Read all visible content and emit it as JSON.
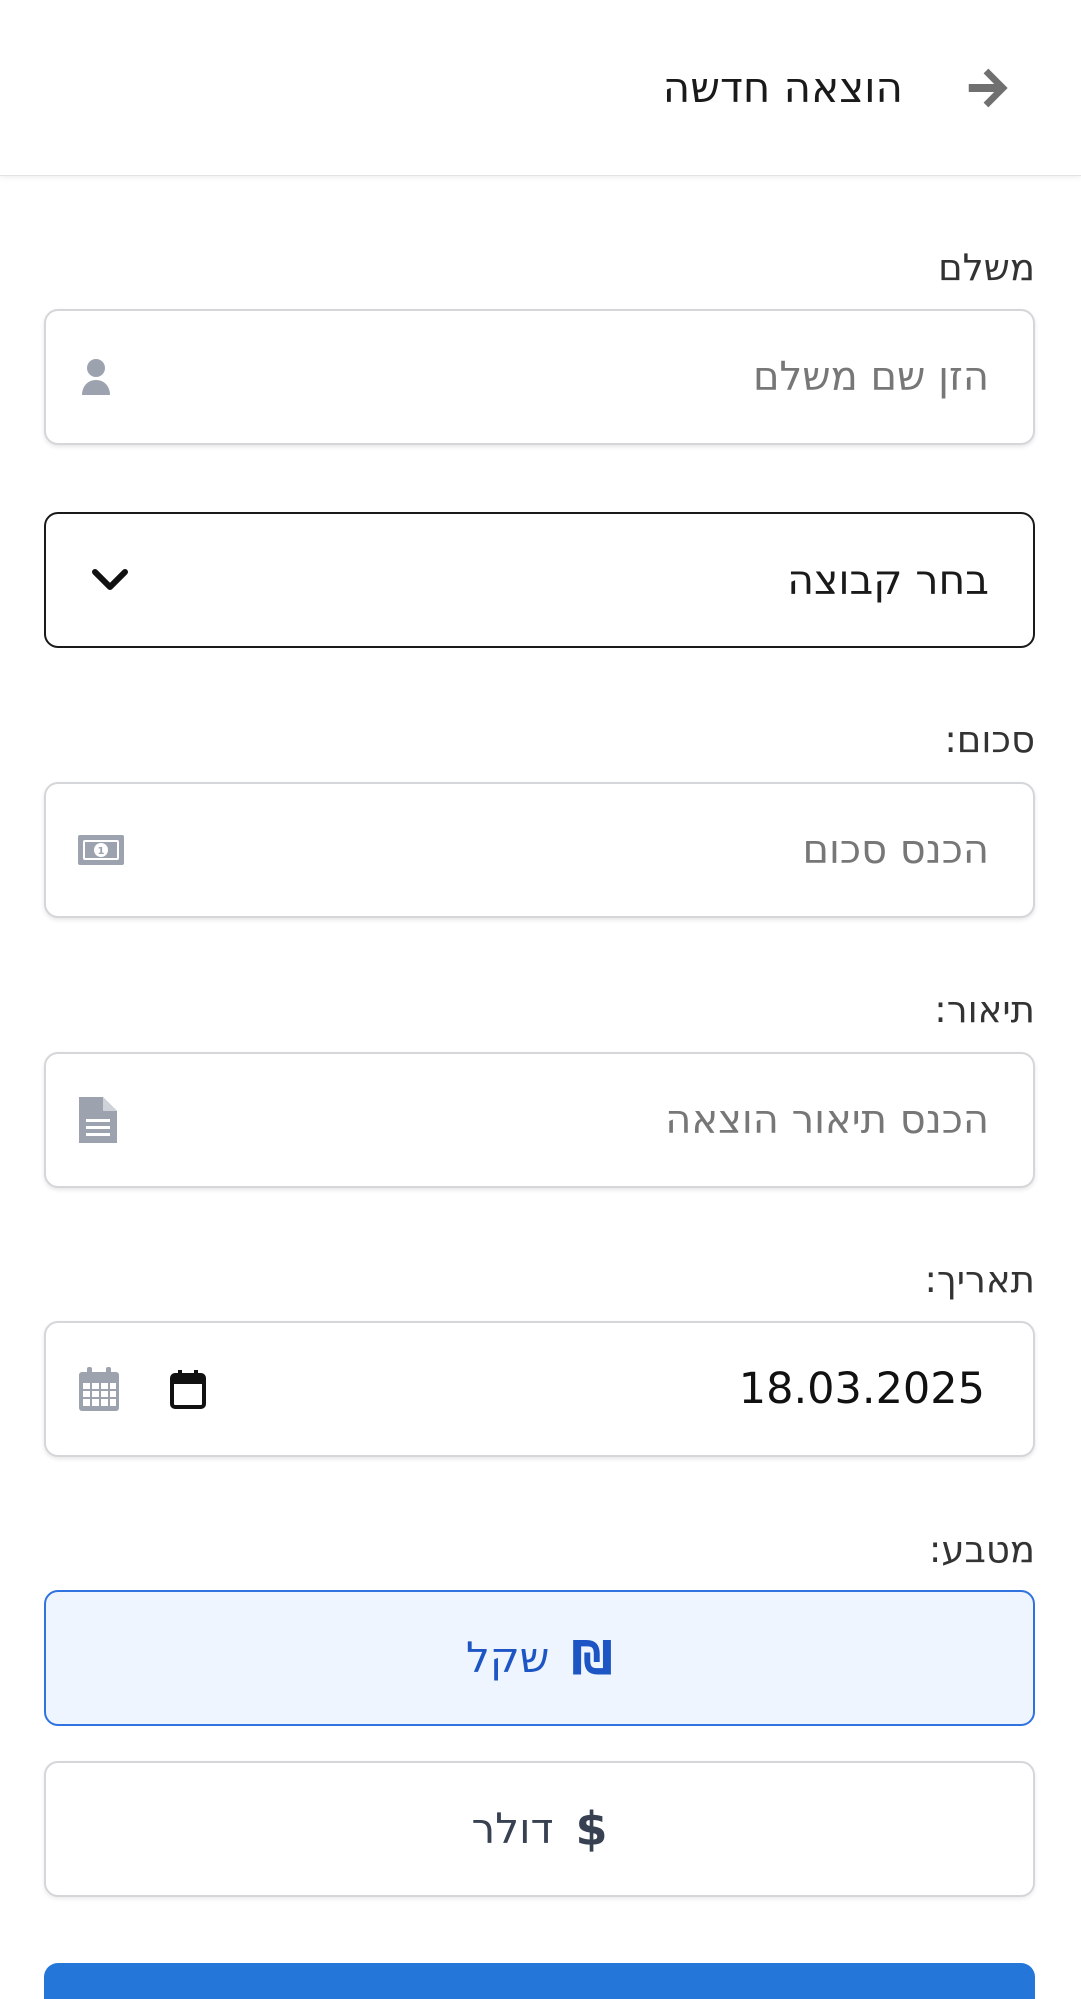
{
  "header": {
    "title": "הוצאה חדשה",
    "back_icon": "arrow-right-icon"
  },
  "payer": {
    "label": "משלם",
    "placeholder": "הזן שם משלם",
    "icon": "user-icon"
  },
  "group_select": {
    "value": "בחר קבוצה",
    "icon": "chevron-down-icon"
  },
  "amount": {
    "label": "סכום:",
    "placeholder": "הכנס סכום",
    "icon": "money-bill-icon"
  },
  "description": {
    "label": "תיאור:",
    "placeholder": "הכנס תיאור הוצאה",
    "icon": "file-icon"
  },
  "date": {
    "label": "תאריך:",
    "value": "18.03.2025",
    "icon": "calendar-icon",
    "picker_icon": "calendar-picker-icon"
  },
  "currency": {
    "label": "מטבע:",
    "options": [
      {
        "symbol": "₪",
        "label": "שקל",
        "selected": true
      },
      {
        "symbol": "$",
        "label": "דולר",
        "selected": false
      }
    ]
  },
  "colors": {
    "accent": "#2f73e0",
    "selected_bg": "#eef5fe",
    "submit": "#2477d8",
    "icon_gray": "#9ca3af"
  }
}
